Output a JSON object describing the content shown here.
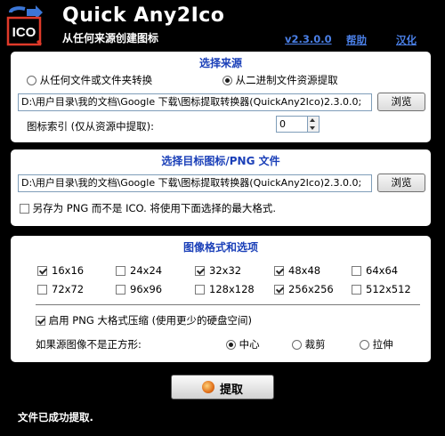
{
  "header": {
    "title": "Quick Any2Ico",
    "subtitle": "从任何来源创建图标",
    "version": "v2.3.0.0",
    "help": "帮助",
    "localize": "汉化",
    "logo_text": "ICO"
  },
  "source": {
    "title": "选择来源",
    "option_file": "从任何文件或文件夹转换",
    "option_binary": "从二进制文件资源提取",
    "selected": "binary",
    "path": "D:\\用户目录\\我的文档\\Google 下载\\图标提取转换器(QuickAny2Ico)2.3.0.0;",
    "browse": "浏览",
    "index_label": "图标索引 (仅从资源中提取):",
    "index_value": "0"
  },
  "target": {
    "title": "选择目标图标/PNG 文件",
    "path": "D:\\用户目录\\我的文档\\Google 下载\\图标提取转换器(QuickAny2Ico)2.3.0.0;",
    "browse": "浏览",
    "save_png_label": "另存为 PNG 而不是 ICO. 将使用下面选择的最大格式.",
    "save_png_checked": false
  },
  "format": {
    "title": "图像格式和选项",
    "sizes": [
      {
        "label": "16x16",
        "checked": true
      },
      {
        "label": "24x24",
        "checked": false
      },
      {
        "label": "32x32",
        "checked": true
      },
      {
        "label": "48x48",
        "checked": true
      },
      {
        "label": "64x64",
        "checked": false
      },
      {
        "label": "72x72",
        "checked": false
      },
      {
        "label": "96x96",
        "checked": false
      },
      {
        "label": "128x128",
        "checked": false
      },
      {
        "label": "256x256",
        "checked": true
      },
      {
        "label": "512x512",
        "checked": false
      }
    ],
    "png_compress_label": "启用 PNG 大格式压缩 (使用更少的硬盘空间)",
    "png_compress_checked": true,
    "non_square_label": "如果源图像不是正方形:",
    "options": [
      "中心",
      "裁剪",
      "拉伸"
    ],
    "selected_option": "中心"
  },
  "actions": {
    "extract": "提取"
  },
  "status": {
    "text": "文件已成功提取."
  }
}
